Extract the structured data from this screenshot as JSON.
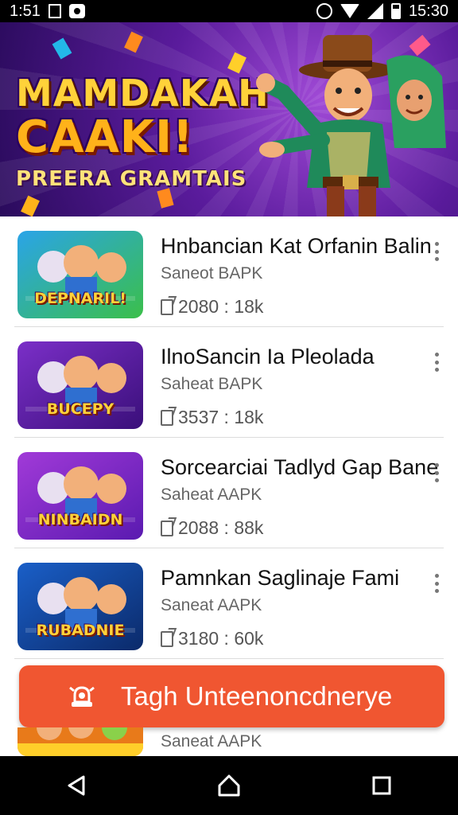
{
  "status_bar": {
    "time_left": "1:51",
    "time_right": "15:30",
    "icons": [
      "n-icon",
      "messenger-icon",
      "alarm-icon",
      "wifi-icon",
      "signal-icon",
      "battery-icon"
    ]
  },
  "banner": {
    "line1": "MAMDAKAH",
    "line2": "CAAKI!",
    "line3": "PREERA GRAMTAIS"
  },
  "apps": [
    {
      "title": "Hnbancian Kat Orfanin Balin",
      "subtitle": "Saneot BAPK",
      "meta": "2080 : 18k",
      "thumb_label": "DEPNARIL!",
      "thumb_colors": [
        "#2aa4e8",
        "#3bbf4a"
      ]
    },
    {
      "title": "IlnoSancin Ia Pleolada",
      "subtitle": "Saheat BAPK",
      "meta": "3537 : 18k",
      "thumb_label": "BUCEPY",
      "thumb_colors": [
        "#7b2fc8",
        "#3a0f7a"
      ]
    },
    {
      "title": "Sorcearciai Tadlyd Gap Bane",
      "subtitle": "Saheat AAPK",
      "meta": "2088 : 88k",
      "thumb_label": "NINBAIDN",
      "thumb_colors": [
        "#a13ad8",
        "#5a1ab0"
      ]
    },
    {
      "title": "Pamnkan Saglinaje Fami",
      "subtitle": "Saneat AAPK",
      "meta": "3180 : 60k",
      "thumb_label": "RUBADNIE",
      "thumb_colors": [
        "#1a5fc8",
        "#0b2a6a"
      ]
    }
  ],
  "cta": {
    "label": "Tagh Unteenoncdnerye"
  },
  "partial_item": {
    "subtitle": "Saneat AAPK"
  },
  "colors": {
    "accent": "#f05631",
    "banner_purple": "#5a1b9c"
  }
}
